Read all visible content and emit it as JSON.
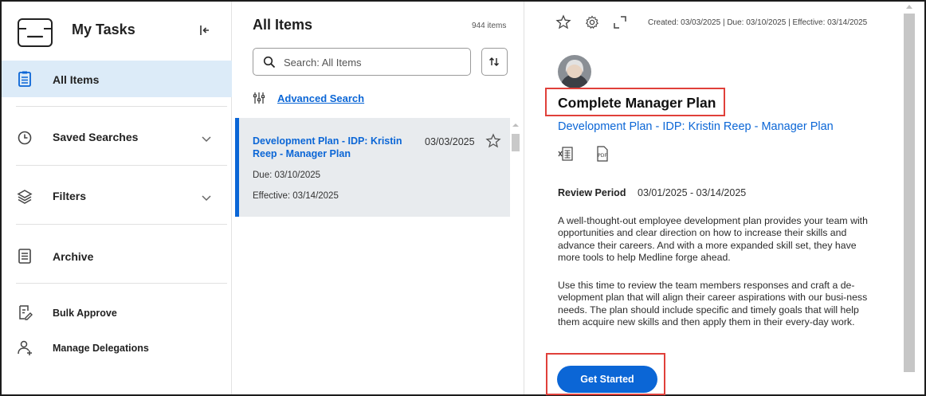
{
  "sidebar": {
    "title": "My Tasks",
    "items": [
      {
        "label": "All Items"
      },
      {
        "label": "Saved Searches"
      },
      {
        "label": "Filters"
      },
      {
        "label": "Archive"
      },
      {
        "label": "Bulk Approve"
      },
      {
        "label": "Manage Delegations"
      }
    ]
  },
  "list": {
    "title": "All Items",
    "count": "944 items",
    "search_placeholder": "Search: All Items",
    "advanced_search": "Advanced Search",
    "cards": [
      {
        "title": "Development Plan - IDP: Kristin Reep - Manager Plan",
        "date": "03/03/2025",
        "due": "Due: 03/10/2025",
        "effective": "Effective: 03/14/2025"
      }
    ]
  },
  "detail": {
    "meta": "Created: 03/03/2025 | Due: 03/10/2025 | Effective: 03/14/2025",
    "title": "Complete Manager Plan",
    "link": "Development Plan - IDP: Kristin Reep - Manager Plan",
    "review_period_label": "Review Period",
    "review_period_value": "03/01/2025 - 03/14/2025",
    "paragraph1": "A well-thought-out employee development plan provides your team with opportunities and clear direction on how to increase their skills and advance their careers. And with a more expanded skill set, they have more tools to help Medline forge ahead.",
    "paragraph2": "Use this time to review the team members responses and craft a de-velopment plan that will align their career aspirations with our busi-ness needs. The plan should include specific and timely goals that will help them acquire new skills and then apply them in their every-day work.",
    "cta": "Get Started",
    "highlight_color": "#e0403a"
  },
  "icons": {
    "logo": "inbox-tray-icon",
    "collapse": "collapse-left-icon",
    "all_items": "clipboard-icon",
    "saved_searches": "clock-icon",
    "filters": "layers-icon",
    "archive": "archive-list-icon",
    "bulk_approve": "edit-doc-icon",
    "delegations": "add-user-icon",
    "star": "star-icon",
    "settings": "gear-icon",
    "expand": "expand-icon",
    "excel": "excel-export-icon",
    "pdf": "pdf-export-icon"
  },
  "colors": {
    "accent": "#0b66d6",
    "active_nav_bg": "#dcebf8",
    "selected_card_bg": "#e8ebee"
  }
}
